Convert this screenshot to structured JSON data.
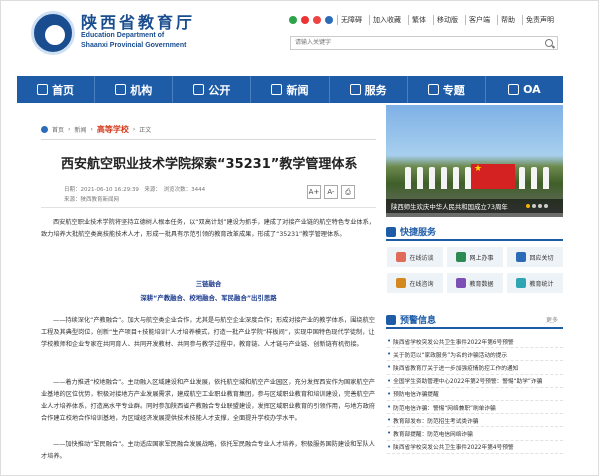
{
  "header": {
    "site_name": "陕西省教育厅",
    "site_en1": "Education Department of",
    "site_en2": "Shaanxi Provincial Government",
    "top_links": [
      "无障碍",
      "加入收藏",
      "繁体",
      "移动版",
      "客户端",
      "帮助",
      "免责声明"
    ],
    "search_placeholder": "请输入关键字"
  },
  "nav": {
    "items": [
      {
        "label": "首页",
        "icon": "home-icon"
      },
      {
        "label": "机构",
        "icon": "building-icon"
      },
      {
        "label": "公开",
        "icon": "public-icon"
      },
      {
        "label": "新闻",
        "icon": "news-icon"
      },
      {
        "label": "服务",
        "icon": "service-icon"
      },
      {
        "label": "专题",
        "icon": "topic-icon"
      },
      {
        "label": "OA",
        "icon": "oa-icon"
      }
    ]
  },
  "breadcrumb": {
    "items": [
      "首页",
      "新闻"
    ],
    "current": "高等学校",
    "tail": "正文"
  },
  "article": {
    "title": "西安航空职业技术学院探索“35231”教学管理体系",
    "meta": "日期：2021-06-10 16:29:39　来源：　浏览次数：3444",
    "source": "来源：陕西教育新闻网",
    "font_buttons": [
      "A+",
      "A-",
      "print"
    ],
    "para1": "西安航空职业技术学院将坚持立德树人根本任务，以“双高计划”建设为抓手，建成了对接产业链的航空特色专业体系，致力培养大批航空类高技能技术人才，形成一批具有示范引领的教育改革成果，形成了“35231”教学管理体系。",
    "section_head": "三链融合",
    "section_sub": "深耕“产教融合、校地融合、军民融合”出引思路",
    "para2": "——持续深化“产教融合”。加大与航空类企业合作，尤其是与航空企业深度合作；形成对接产业的教学体系，围绕航空工程及其典型岗位，创新“生产项目+技能培训”人才培养模式，打造一批产业学院“样板间”，实现中国特色现代学徒制，让学校教师和企业专家在共同育人、共同开发教材、共同参与教学过程中，教育链、人才链与产业链、创新链有机衔接。",
    "para3": "——着力推进“校地融合”。主动融入区域建设和产业发展，依托航空城和航空产业园区，充分发挥西安作为国家航空产业基地的区位优势，积极对接地方产业发展需求，建成航空工业职业教育集团，参与区域职业教育和培训建设，完善航空产业人才培养体系，打造高水平专业群。同时参加陕西省产教融合专业联盟建设，发挥区域职业教育的引领作用，与地方政府合作建立校地合作培训基地，为区域经济发展提供技术技能人才支撑，全面提升学校办学水平。",
    "para4": "——加快推动“军民融合”。主动适应国家军民融合发展战略，依托军民融合专业人才培养，积极服务国防建设和军队人才培养。"
  },
  "slider": {
    "caption": "陕西师生欢庆中华人民共和国成立73周年"
  },
  "quick": {
    "title": "快捷服务",
    "items": [
      {
        "label": "在线访谈",
        "icon": "interview-icon",
        "color": "#e06b5a"
      },
      {
        "label": "网上办事",
        "icon": "office-icon",
        "color": "#2c8a52"
      },
      {
        "label": "回应关切",
        "icon": "response-icon",
        "color": "#2c6bb8"
      },
      {
        "label": "在线咨询",
        "icon": "consult-icon",
        "color": "#d4881e"
      },
      {
        "label": "教育数据",
        "icon": "data-icon",
        "color": "#7b4fb3"
      },
      {
        "label": "教育统计",
        "icon": "stats-icon",
        "color": "#2ea5b3"
      }
    ]
  },
  "notices": {
    "title": "预警信息",
    "more": "更多",
    "items": [
      "陕西省学校突发公共卫生事件2022年第6号预警",
      "关于防范以“家政服务”为名的诈骗活动的提示",
      "陕西省教育厅关于进一步加强疫情防控工作的通知",
      "全国学生资助管理中心2022年第2号预警：警惕“助学”诈骗",
      "预防电信诈骗提醒",
      "防范电信诈骗：警惕“网络兼职”刷单诈骗",
      "教育部发布：防范招生考试类诈骗",
      "教育部提醒：防范电信网络诈骗",
      "陕西省学校突发公共卫生事件2022年第4号预警"
    ]
  }
}
